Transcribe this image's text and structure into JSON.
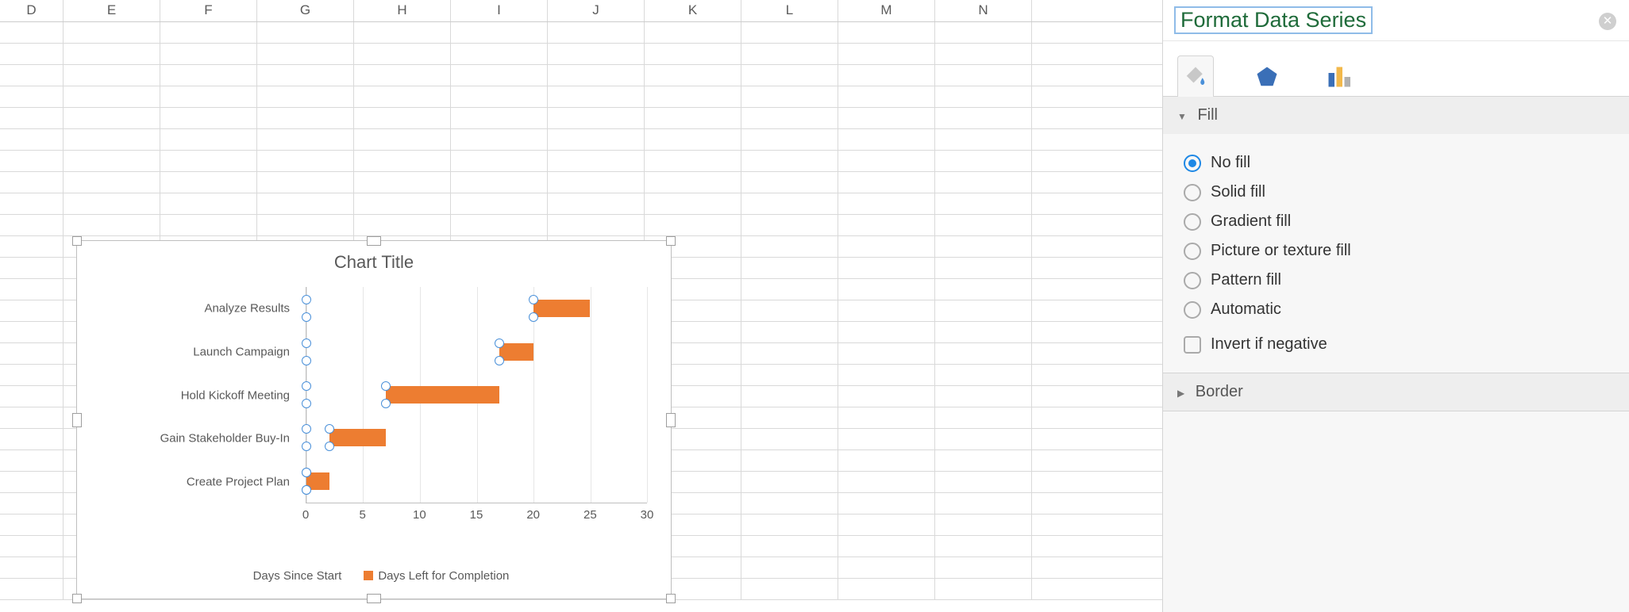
{
  "columns": [
    "D",
    "E",
    "F",
    "G",
    "H",
    "I",
    "J",
    "K",
    "L",
    "M",
    "N"
  ],
  "row_count": 27,
  "panel": {
    "title": "Format Data Series",
    "section_fill": "Fill",
    "section_border": "Border",
    "fill_options": [
      "No fill",
      "Solid fill",
      "Gradient fill",
      "Picture or texture fill",
      "Pattern fill",
      "Automatic"
    ],
    "fill_selected": "No fill",
    "invert_label": "Invert if negative"
  },
  "chart_data": {
    "type": "bar",
    "title": "Chart Title",
    "xlabel": "",
    "ylabel": "",
    "xlim": [
      0,
      30
    ],
    "xticks": [
      0,
      5,
      10,
      15,
      20,
      25,
      30
    ],
    "categories": [
      "Create Project Plan",
      "Gain Stakeholder Buy-In",
      "Hold Kickoff Meeting",
      "Launch Campaign",
      "Analyze Results"
    ],
    "series": [
      {
        "name": "Days Since Start",
        "values": [
          0,
          2,
          7,
          17,
          20
        ],
        "color": "transparent",
        "selected": true
      },
      {
        "name": "Days Left for Completion",
        "values": [
          2,
          5,
          10,
          3,
          5
        ],
        "color": "#ed7d31"
      }
    ],
    "legend_position": "bottom"
  }
}
